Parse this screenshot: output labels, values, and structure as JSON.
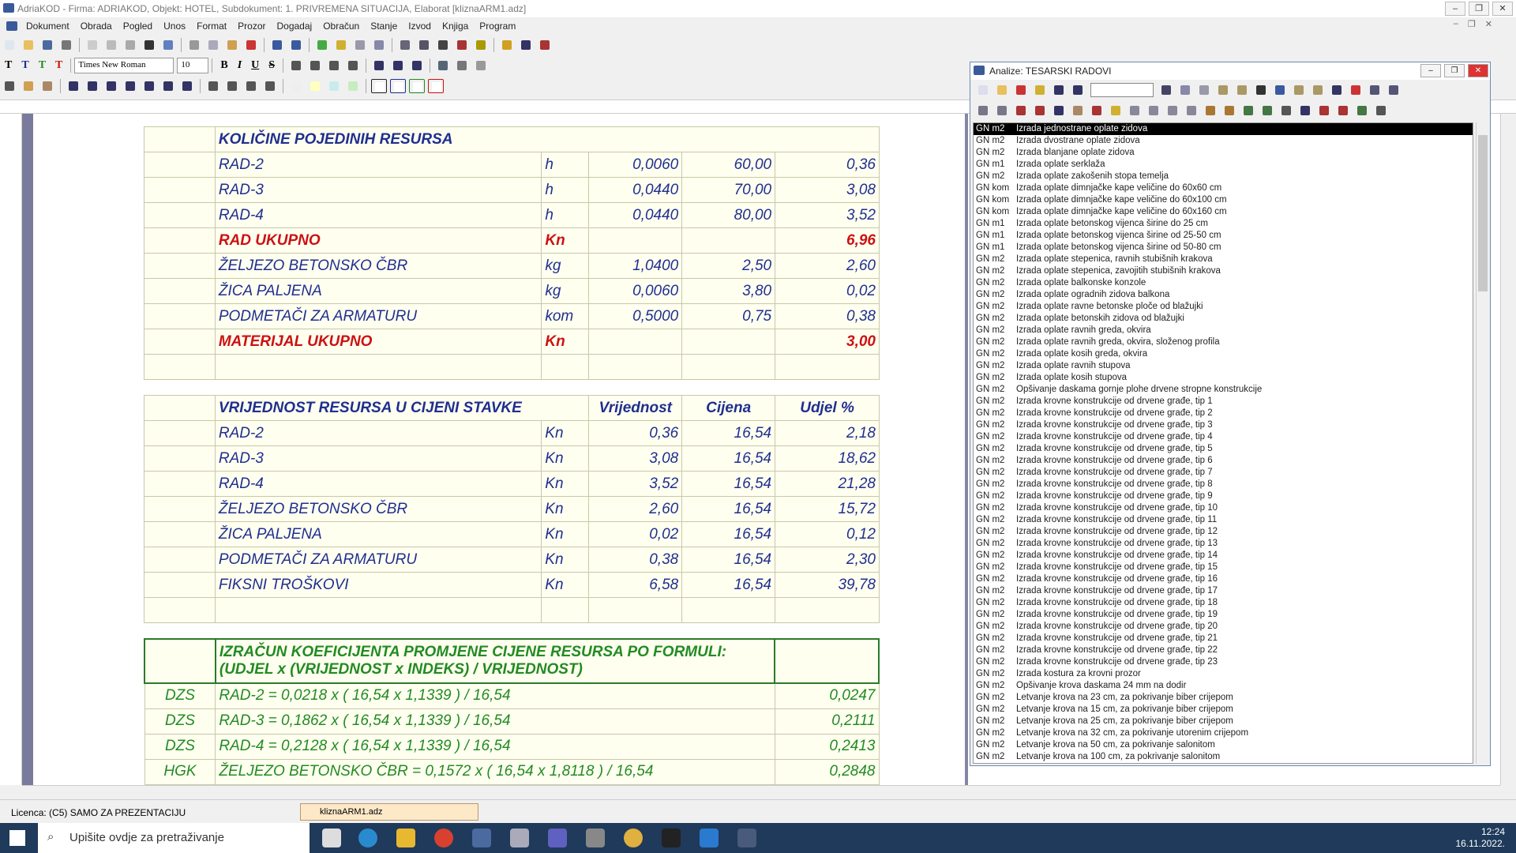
{
  "app": {
    "title": "AdriaKOD - Firma: ADRIAKOD,  Objekt: HOTEL,  Subdokument: 1. PRIVREMENA SITUACIJA,  Elaborat [kliznaARM1.adz]"
  },
  "menu": [
    "Dokument",
    "Obrada",
    "Pogled",
    "Unos",
    "Format",
    "Prozor",
    "Dogadaj",
    "Obračun",
    "Stanje",
    "Izvod",
    "Knjiga",
    "Program"
  ],
  "format": {
    "t_labels": [
      "T",
      "T",
      "T",
      "T"
    ],
    "t_colors": [
      "#222222",
      "#1f2f8f",
      "#228b22",
      "#cc1111"
    ],
    "font": "Times New Roman",
    "size": "10",
    "bold": "B",
    "italic": "I",
    "underline": "U",
    "strike": "S"
  },
  "doc": {
    "sec1": {
      "title": "KOLIČINE POJEDINIH RESURSA",
      "rows": [
        {
          "name": "RAD-2",
          "unit": "h",
          "qty": "0,0060",
          "price": "60,00",
          "total": "0,36",
          "red": false
        },
        {
          "name": "RAD-3",
          "unit": "h",
          "qty": "0,0440",
          "price": "70,00",
          "total": "3,08",
          "red": false
        },
        {
          "name": "RAD-4",
          "unit": "h",
          "qty": "0,0440",
          "price": "80,00",
          "total": "3,52",
          "red": false
        },
        {
          "name": "RAD UKUPNO",
          "unit": "Kn",
          "qty": "",
          "price": "",
          "total": "6,96",
          "red": true
        },
        {
          "name": "ŽELJEZO BETONSKO ČBR",
          "unit": "kg",
          "qty": "1,0400",
          "price": "2,50",
          "total": "2,60",
          "red": false
        },
        {
          "name": "ŽICA PALJENA",
          "unit": "kg",
          "qty": "0,0060",
          "price": "3,80",
          "total": "0,02",
          "red": false
        },
        {
          "name": "PODMETAČI ZA ARMATURU",
          "unit": "kom",
          "qty": "0,5000",
          "price": "0,75",
          "total": "0,38",
          "red": false
        },
        {
          "name": "MATERIJAL UKUPNO",
          "unit": "Kn",
          "qty": "",
          "price": "",
          "total": "3,00",
          "red": true
        }
      ]
    },
    "sec2": {
      "title": "VRIJEDNOST RESURSA U CIJENI STAVKE",
      "h_value": "Vrijednost",
      "h_price": "Cijena",
      "h_share": "Udjel %",
      "rows": [
        {
          "name": "RAD-2",
          "unit": "Kn",
          "value": "0,36",
          "price": "16,54",
          "share": "2,18"
        },
        {
          "name": "RAD-3",
          "unit": "Kn",
          "value": "3,08",
          "price": "16,54",
          "share": "18,62"
        },
        {
          "name": "RAD-4",
          "unit": "Kn",
          "value": "3,52",
          "price": "16,54",
          "share": "21,28"
        },
        {
          "name": "ŽELJEZO BETONSKO ČBR",
          "unit": "Kn",
          "value": "2,60",
          "price": "16,54",
          "share": "15,72"
        },
        {
          "name": "ŽICA PALJENA",
          "unit": "Kn",
          "value": "0,02",
          "price": "16,54",
          "share": "0,12"
        },
        {
          "name": "PODMETAČI ZA ARMATURU",
          "unit": "Kn",
          "value": "0,38",
          "price": "16,54",
          "share": "2,30"
        },
        {
          "name": "FIKSNI TROŠKOVI",
          "unit": "Kn",
          "value": "6,58",
          "price": "16,54",
          "share": "39,78"
        }
      ]
    },
    "sec3": {
      "title_l1": "IZRAČUN KOEFICIJENTA PROMJENE CIJENE RESURSA PO FORMULI:",
      "title_l2": "(UDJEL x (VRIJEDNOST x INDEKS) / VRIJEDNOST)",
      "rows": [
        {
          "code": "DZS",
          "formula": "RAD-2 = 0,0218 x ( 16,54 x 1,1339 ) / 16,54",
          "coef": "0,0247"
        },
        {
          "code": "DZS",
          "formula": "RAD-3 = 0,1862 x ( 16,54 x 1,1339 ) / 16,54",
          "coef": "0,2111"
        },
        {
          "code": "DZS",
          "formula": "RAD-4 = 0,2128 x ( 16,54 x 1,1339 ) / 16,54",
          "coef": "0,2413"
        },
        {
          "code": "HGK",
          "formula": "ŽELJEZO BETONSKO ČBR = 0,1572 x ( 16,54 x 1,8118 ) / 16,54",
          "coef": "0,2848"
        }
      ]
    }
  },
  "panel": {
    "title": "Analize: TESARSKI RADOVI",
    "items": [
      {
        "u": "GN m2",
        "t": "Izrada jednostrane oplate zidova"
      },
      {
        "u": "GN m2",
        "t": "Izrada dvostrane oplate zidova"
      },
      {
        "u": "GN m2",
        "t": "Izrada blanjane oplate zidova"
      },
      {
        "u": "GN m1",
        "t": "Izrada oplate serklaža"
      },
      {
        "u": "GN m2",
        "t": "Izrada oplate zakošenih stopa temelja"
      },
      {
        "u": "GN kom",
        "t": "Izrada oplate dimnjačke kape veličine do 60x60 cm"
      },
      {
        "u": "GN kom",
        "t": "Izrada oplate dimnjačke kape veličine do 60x100 cm"
      },
      {
        "u": "GN kom",
        "t": "Izrada oplate dimnjačke kape veličine do 60x160 cm"
      },
      {
        "u": "GN m1",
        "t": "Izrada oplate betonskog vijenca širine do 25 cm"
      },
      {
        "u": "GN m1",
        "t": "Izrada oplate betonskog vijenca širine od 25-50 cm"
      },
      {
        "u": "GN m1",
        "t": "Izrada oplate betonskog vijenca širine od 50-80 cm"
      },
      {
        "u": "GN m2",
        "t": "Izrada oplate stepenica, ravnih stubišnih krakova"
      },
      {
        "u": "GN m2",
        "t": "Izrada oplate stepenica, zavojitih stubišnih krakova"
      },
      {
        "u": "GN m2",
        "t": "Izrada oplate balkonske konzole"
      },
      {
        "u": "GN m2",
        "t": "Izrada oplate ogradnih zidova balkona"
      },
      {
        "u": "GN m2",
        "t": "Izrada oplate ravne betonske ploče od blažujki"
      },
      {
        "u": "GN m2",
        "t": "Izrada oplate betonskih zidova od blažujki"
      },
      {
        "u": "GN m2",
        "t": "Izrada oplate ravnih greda, okvira"
      },
      {
        "u": "GN m2",
        "t": "Izrada oplate ravnih greda, okvira, složenog profila"
      },
      {
        "u": "GN m2",
        "t": "Izrada oplate kosih greda, okvira"
      },
      {
        "u": "GN m2",
        "t": "Izrada oplate ravnih stupova"
      },
      {
        "u": "GN m2",
        "t": "Izrada oplate kosih stupova"
      },
      {
        "u": "GN m2",
        "t": "Opšivanje daskama gornje plohe drvene stropne konstrukcije"
      },
      {
        "u": "GN m2",
        "t": "Izrada krovne konstrukcije od drvene građe, tip 1"
      },
      {
        "u": "GN m2",
        "t": "Izrada krovne konstrukcije od drvene građe, tip 2"
      },
      {
        "u": "GN m2",
        "t": "Izrada krovne konstrukcije od drvene građe, tip 3"
      },
      {
        "u": "GN m2",
        "t": "Izrada krovne konstrukcije od drvene građe, tip 4"
      },
      {
        "u": "GN m2",
        "t": "Izrada krovne konstrukcije od drvene građe, tip 5"
      },
      {
        "u": "GN m2",
        "t": "Izrada krovne konstrukcije od drvene građe, tip 6"
      },
      {
        "u": "GN m2",
        "t": "Izrada krovne konstrukcije od drvene građe, tip 7"
      },
      {
        "u": "GN m2",
        "t": "Izrada krovne konstrukcije od drvene građe, tip 8"
      },
      {
        "u": "GN m2",
        "t": "Izrada krovne konstrukcije od drvene građe, tip 9"
      },
      {
        "u": "GN m2",
        "t": "Izrada krovne konstrukcije od drvene građe, tip 10"
      },
      {
        "u": "GN m2",
        "t": "Izrada krovne konstrukcije od drvene građe, tip 11"
      },
      {
        "u": "GN m2",
        "t": "Izrada krovne konstrukcije od drvene građe, tip 12"
      },
      {
        "u": "GN m2",
        "t": "Izrada krovne konstrukcije od drvene građe, tip 13"
      },
      {
        "u": "GN m2",
        "t": "Izrada krovne konstrukcije od drvene građe, tip 14"
      },
      {
        "u": "GN m2",
        "t": "Izrada krovne konstrukcije od drvene građe, tip 15"
      },
      {
        "u": "GN m2",
        "t": "Izrada krovne konstrukcije od drvene građe, tip 16"
      },
      {
        "u": "GN m2",
        "t": "Izrada krovne konstrukcije od drvene građe, tip 17"
      },
      {
        "u": "GN m2",
        "t": "Izrada krovne konstrukcije od drvene građe, tip 18"
      },
      {
        "u": "GN m2",
        "t": "Izrada krovne konstrukcije od drvene građe, tip 19"
      },
      {
        "u": "GN m2",
        "t": "Izrada krovne konstrukcije od drvene građe, tip 20"
      },
      {
        "u": "GN m2",
        "t": "Izrada krovne konstrukcije od drvene građe, tip 21"
      },
      {
        "u": "GN m2",
        "t": "Izrada krovne konstrukcije od drvene građe, tip 22"
      },
      {
        "u": "GN m2",
        "t": "Izrada krovne konstrukcije od drvene građe, tip 23"
      },
      {
        "u": "GN m2",
        "t": "Izrada kostura za krovni prozor"
      },
      {
        "u": "GN m2",
        "t": "Opšivanje krova daskama 24 mm na dodir"
      },
      {
        "u": "GN m2",
        "t": "Letvanje krova na 23 cm, za pokrivanje biber crijepom"
      },
      {
        "u": "GN m2",
        "t": "Letvanje krova na 15 cm, za pokrivanje biber crijepom"
      },
      {
        "u": "GN m2",
        "t": "Letvanje krova na 25 cm, za pokrivanje biber crijepom"
      },
      {
        "u": "GN m2",
        "t": "Letvanje krova na 32 cm, za pokrivanje utorenim crijepom"
      },
      {
        "u": "GN m2",
        "t": "Letvanje krova na 50 cm, za pokrivanje salonitom"
      },
      {
        "u": "GN m2",
        "t": "Letvanje krova na 100 cm, za pokrivanje salonitom"
      }
    ]
  },
  "status": {
    "licence": "Licenca:  (C5) SAMO ZA PREZENTACIJU",
    "doc_tab": "kliznaARM1.adz"
  },
  "taskbar": {
    "search": "Upišite ovdje za pretraživanje",
    "time": "12:24",
    "date": "16.11.2022."
  }
}
